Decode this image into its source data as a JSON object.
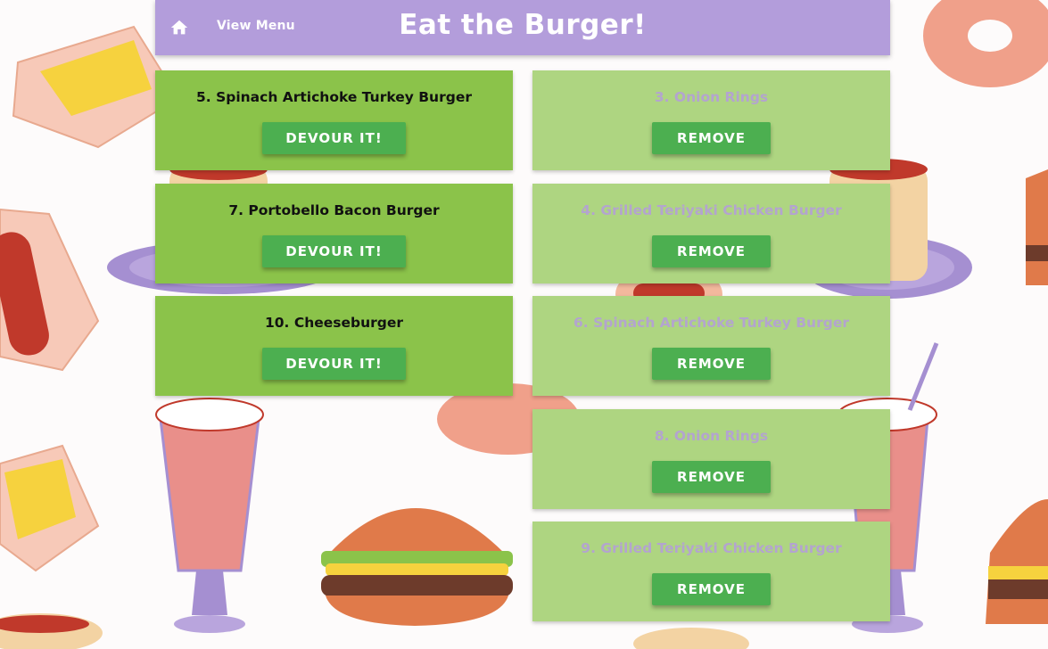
{
  "navbar": {
    "home_icon": "home-icon",
    "view_menu_label": "View Menu",
    "brand_title": "Eat the Burger!",
    "background_color": "#b39ddb"
  },
  "devour_list": [
    {
      "title": "5. Spinach Artichoke Turkey Burger",
      "button_label": "DEVOUR IT!"
    },
    {
      "title": "7. Portobello Bacon Burger",
      "button_label": "DEVOUR IT!"
    },
    {
      "title": "10. Cheeseburger",
      "button_label": "DEVOUR IT!"
    }
  ],
  "devoured_list": [
    {
      "title": "3. Onion Rings",
      "button_label": "REMOVE"
    },
    {
      "title": "4. Grilled Teriyaki Chicken Burger",
      "button_label": "REMOVE"
    },
    {
      "title": "6. Spinach Artichoke Turkey Burger",
      "button_label": "REMOVE"
    },
    {
      "title": "8. Onion Rings",
      "button_label": "REMOVE"
    },
    {
      "title": "9. Grilled Teriyaki Chicken Burger",
      "button_label": "REMOVE"
    }
  ],
  "colors": {
    "devour_card": "#8bc34a",
    "devoured_card": "#aed581",
    "button": "#4caf50",
    "devoured_text": "#b3a4cf"
  }
}
